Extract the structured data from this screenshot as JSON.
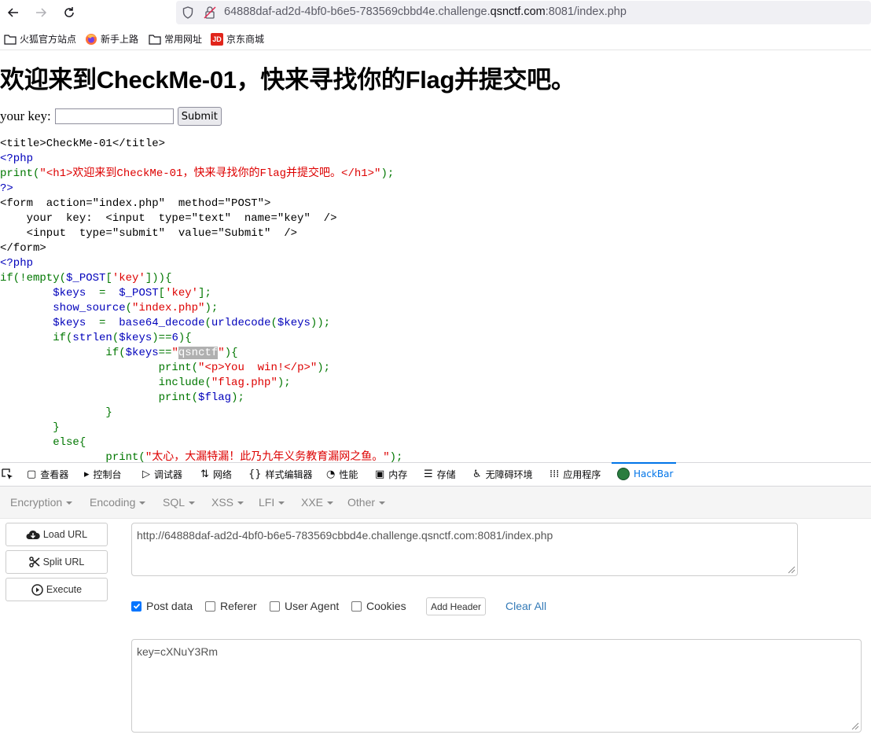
{
  "browser": {
    "url_prefix": "64888daf-ad2d-4bf0-b6e5-783569cbbd4e.challenge.",
    "url_domain": "qsnctf.com",
    "url_suffix": ":8081/index.php",
    "bookmarks": [
      "火狐官方站点",
      "新手上路",
      "常用网址",
      "京东商城"
    ],
    "jd_badge": "JD"
  },
  "page": {
    "heading": "欢迎来到CheckMe-01，快来寻找你的Flag并提交吧。",
    "key_label": "your key: ",
    "submit_label": "Submit"
  },
  "source_lines": [
    [
      {
        "c": "html",
        "t": "<title>CheckMe-01</title>"
      }
    ],
    [
      {
        "c": "var",
        "t": "<?php"
      }
    ],
    [
      {
        "c": "kw",
        "t": "print("
      },
      {
        "c": "str",
        "t": "\"<h1>欢迎来到CheckMe-01，快来寻找你的Flag并提交吧。</h1>\""
      },
      {
        "c": "kw",
        "t": ");"
      }
    ],
    [
      {
        "c": "var",
        "t": "?>"
      }
    ],
    [
      {
        "c": "html",
        "t": "<form  action=\"index.php\"  method=\"POST\">"
      }
    ],
    [
      {
        "c": "html",
        "t": "    your  key:  <input  type=\"text\"  name=\"key\"  />"
      }
    ],
    [
      {
        "c": "html",
        "t": "    <input  type=\"submit\"  value=\"Submit\"  />"
      }
    ],
    [
      {
        "c": "html",
        "t": "</form>"
      }
    ],
    [
      {
        "c": "var",
        "t": "<?php"
      }
    ],
    [
      {
        "c": "kw",
        "t": "if(!empty("
      },
      {
        "c": "var",
        "t": "$_POST"
      },
      {
        "c": "kw",
        "t": "["
      },
      {
        "c": "str",
        "t": "'key'"
      },
      {
        "c": "kw",
        "t": "])){"
      }
    ],
    [
      {
        "c": "kw",
        "t": "        "
      },
      {
        "c": "var",
        "t": "$keys  "
      },
      {
        "c": "kw",
        "t": "=  "
      },
      {
        "c": "var",
        "t": "$_POST"
      },
      {
        "c": "kw",
        "t": "["
      },
      {
        "c": "str",
        "t": "'key'"
      },
      {
        "c": "kw",
        "t": "];"
      }
    ],
    [
      {
        "c": "kw",
        "t": "        "
      },
      {
        "c": "var",
        "t": "show_source"
      },
      {
        "c": "kw",
        "t": "("
      },
      {
        "c": "str",
        "t": "\"index.php\""
      },
      {
        "c": "kw",
        "t": ");"
      }
    ],
    [
      {
        "c": "kw",
        "t": "        "
      },
      {
        "c": "var",
        "t": "$keys  "
      },
      {
        "c": "kw",
        "t": "=  "
      },
      {
        "c": "var",
        "t": "base64_decode"
      },
      {
        "c": "kw",
        "t": "("
      },
      {
        "c": "var",
        "t": "urldecode"
      },
      {
        "c": "kw",
        "t": "("
      },
      {
        "c": "var",
        "t": "$keys"
      },
      {
        "c": "kw",
        "t": "));"
      }
    ],
    [
      {
        "c": "kw",
        "t": "        if("
      },
      {
        "c": "var",
        "t": "strlen"
      },
      {
        "c": "kw",
        "t": "("
      },
      {
        "c": "var",
        "t": "$keys"
      },
      {
        "c": "kw",
        "t": ")=="
      },
      {
        "c": "var",
        "t": "6"
      },
      {
        "c": "kw",
        "t": "){"
      }
    ],
    [
      {
        "c": "kw",
        "t": "                if("
      },
      {
        "c": "var",
        "t": "$keys"
      },
      {
        "c": "kw",
        "t": "=="
      },
      {
        "c": "str",
        "t": "\""
      },
      {
        "c": "sel",
        "t": "qsnctf"
      },
      {
        "c": "str",
        "t": "\""
      },
      {
        "c": "kw",
        "t": "){"
      }
    ],
    [
      {
        "c": "kw",
        "t": "                        print("
      },
      {
        "c": "str",
        "t": "\"<p>You  win!</p>\""
      },
      {
        "c": "kw",
        "t": ");"
      }
    ],
    [
      {
        "c": "kw",
        "t": "                        include("
      },
      {
        "c": "str",
        "t": "\"flag.php\""
      },
      {
        "c": "kw",
        "t": ");"
      }
    ],
    [
      {
        "c": "kw",
        "t": "                        print("
      },
      {
        "c": "var",
        "t": "$flag"
      },
      {
        "c": "kw",
        "t": ");"
      }
    ],
    [
      {
        "c": "kw",
        "t": "                }"
      }
    ],
    [
      {
        "c": "kw",
        "t": "        }"
      }
    ],
    [
      {
        "c": "kw",
        "t": "        else{"
      }
    ],
    [
      {
        "c": "kw",
        "t": "                print("
      },
      {
        "c": "str",
        "t": "\"太心，大漏特漏！此乃九年义务教育漏网之鱼。\""
      },
      {
        "c": "kw",
        "t": ");"
      }
    ]
  ],
  "devtools": {
    "tabs": [
      "查看器",
      "控制台",
      "调试器",
      "网络",
      "样式编辑器",
      "性能",
      "内存",
      "存储",
      "无障碍环境",
      "应用程序",
      "HackBar"
    ]
  },
  "hackbar": {
    "menu": [
      "Encryption",
      "Encoding",
      "SQL",
      "XSS",
      "LFI",
      "XXE",
      "Other"
    ],
    "load_url": "Load URL",
    "split_url": "Split URL",
    "execute": "Execute",
    "url_value": "http://64888daf-ad2d-4bf0-b6e5-783569cbbd4e.challenge.qsnctf.com:8081/index.php",
    "options": [
      {
        "label": "Post data",
        "checked": true
      },
      {
        "label": "Referer",
        "checked": false
      },
      {
        "label": "User Agent",
        "checked": false
      },
      {
        "label": "Cookies",
        "checked": false
      }
    ],
    "add_header": "Add Header",
    "clear_all": "Clear All",
    "post_value": "key=cXNuY3Rm",
    "accent": "#0074e8"
  }
}
